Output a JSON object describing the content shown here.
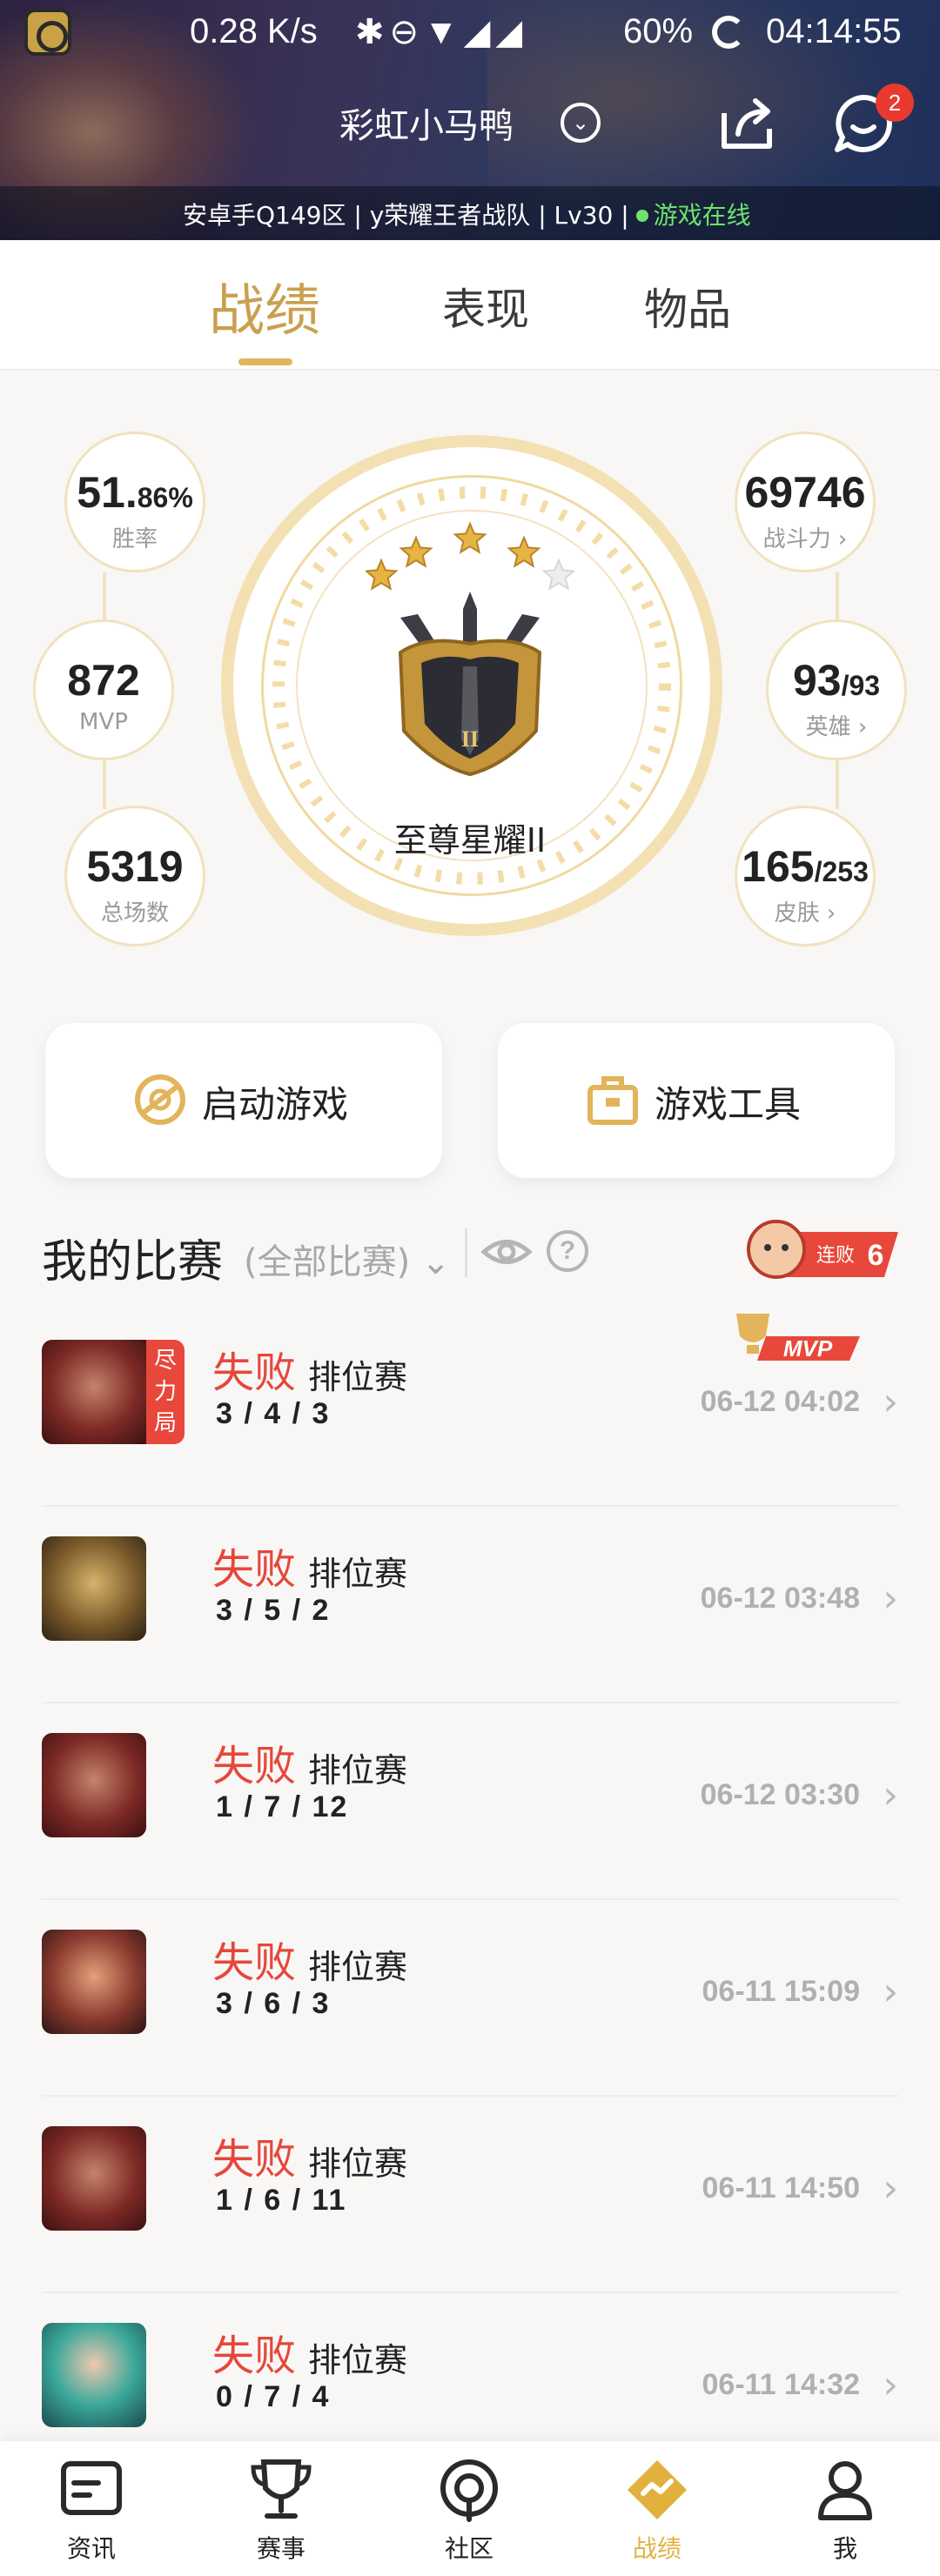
{
  "status_bar": {
    "speed": "0.28 K/s",
    "battery": "60%",
    "time": "04:14:55"
  },
  "header": {
    "player_name": "彩虹小马鸭",
    "server_info": "安卓手Q149区 | y荣耀王者战队 | Lv30 |",
    "online_status": "游戏在线",
    "notification_count": "2"
  },
  "tabs": [
    {
      "label": "战绩",
      "active": true
    },
    {
      "label": "表现",
      "active": false
    },
    {
      "label": "物品",
      "active": false
    }
  ],
  "stats": {
    "win_rate_main": "51.",
    "win_rate_dec": "86%",
    "win_rate_label": "胜率",
    "mvp_value": "872",
    "mvp_label": "MVP",
    "total_games": "5319",
    "total_games_label": "总场数",
    "power_value": "69746",
    "power_label": "战斗力",
    "heroes_owned": "93",
    "heroes_total": "/93",
    "heroes_label": "英雄",
    "skins_owned": "165",
    "skins_total": "/253",
    "skins_label": "皮肤"
  },
  "rank": {
    "name": "至尊星耀II",
    "stars_filled": 4,
    "stars_total": 5
  },
  "actions": {
    "launch_game": "启动游戏",
    "game_tools": "游戏工具"
  },
  "matches_header": {
    "title": "我的比赛",
    "filter": "(全部比赛)",
    "streak_label": "连败",
    "streak_count": "6"
  },
  "matches": [
    {
      "result": "失败",
      "mode": "排位赛",
      "kda": "3 / 4 / 3",
      "time": "06-12 04:02",
      "tag": "尽力局",
      "mvp": "MVP"
    },
    {
      "result": "失败",
      "mode": "排位赛",
      "kda": "3 / 5 / 2",
      "time": "06-12 03:48"
    },
    {
      "result": "失败",
      "mode": "排位赛",
      "kda": "1 / 7 / 12",
      "time": "06-12 03:30"
    },
    {
      "result": "失败",
      "mode": "排位赛",
      "kda": "3 / 6 / 3",
      "time": "06-11 15:09"
    },
    {
      "result": "失败",
      "mode": "排位赛",
      "kda": "1 / 6 / 11",
      "time": "06-11 14:50"
    },
    {
      "result": "失败",
      "mode": "排位赛",
      "kda": "0 / 7 / 4",
      "time": "06-11 14:32"
    }
  ],
  "bottom_nav": [
    {
      "label": "资讯",
      "icon": "news-icon"
    },
    {
      "label": "赛事",
      "icon": "trophy-icon"
    },
    {
      "label": "社区",
      "icon": "community-icon"
    },
    {
      "label": "战绩",
      "icon": "record-icon",
      "active": true
    },
    {
      "label": "我",
      "icon": "profile-icon"
    }
  ],
  "colors": {
    "accent_gold": "#e2b45b",
    "loss_red": "#e5473b",
    "online_green": "#6ee36a"
  }
}
